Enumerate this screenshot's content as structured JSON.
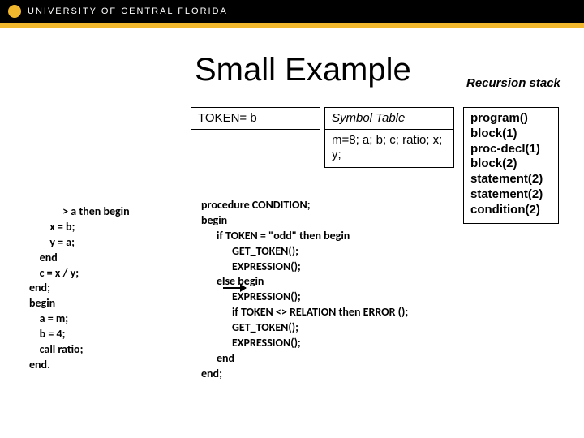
{
  "brand": {
    "name": "UNIVERSITY OF CENTRAL FLORIDA"
  },
  "slide": {
    "title": "Small Example",
    "recursion_label": "Recursion stack"
  },
  "token_box": "TOKEN= b",
  "symbol_table": {
    "header": "Symbol Table",
    "body": "m=8; a; b; c; ratio; x; y;"
  },
  "stack": [
    "program()",
    "block(1)",
    "proc-decl(1)",
    "block(2)",
    "statement(2)",
    "statement(2)",
    "condition(2)"
  ],
  "code_left": "             > a then begin\n        x = b;\n        y = a;\n    end\n    c = x / y;\nend;\nbegin\n    a = m;\n    b = 4;\n    call ratio;\nend.",
  "code_right": "procedure CONDITION;\nbegin\n      if TOKEN = \"odd\" then begin\n            GET_TOKEN();\n            EXPRESSION();\n      else begin\n            EXPRESSION();\n            if TOKEN <> RELATION then ERROR ();\n            GET_TOKEN();\n            EXPRESSION();\n      end\nend;"
}
